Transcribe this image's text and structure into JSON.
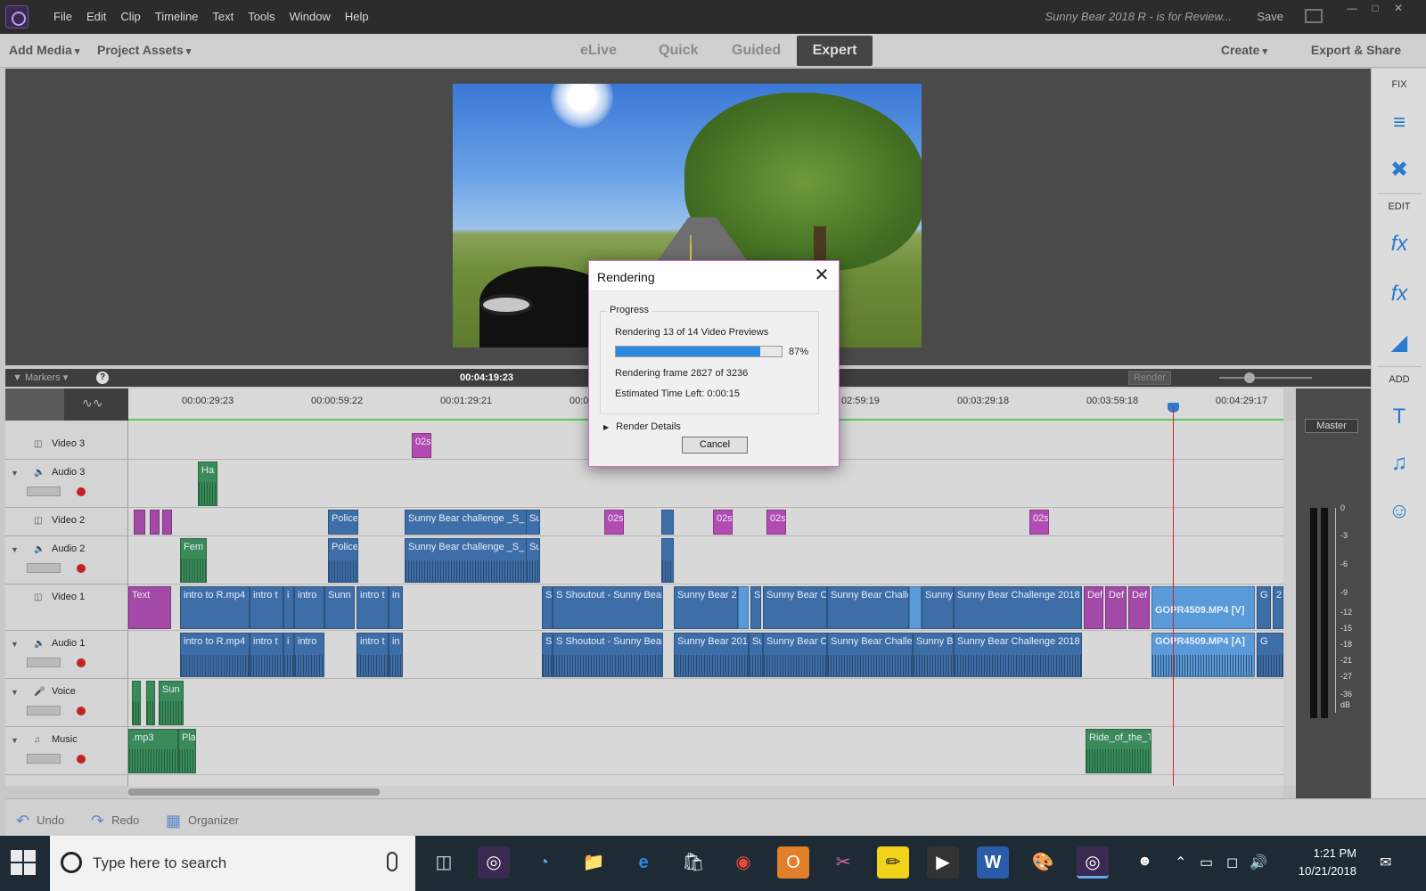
{
  "titlebar": {
    "menu": [
      "File",
      "Edit",
      "Clip",
      "Timeline",
      "Text",
      "Tools",
      "Window",
      "Help"
    ],
    "document_title": "Sunny Bear 2018 R - is for Review...",
    "save_label": "Save"
  },
  "modebar": {
    "add_media": "Add Media",
    "project_assets": "Project Assets",
    "tabs": [
      "eLive",
      "Quick",
      "Guided",
      "Expert"
    ],
    "active_tab": "Expert",
    "create": "Create",
    "export_share": "Export & Share"
  },
  "render_dialog": {
    "title": "Rendering",
    "group_label": "Progress",
    "status_line": "Rendering 13 of 14 Video Previews",
    "progress_percent": 87,
    "percent_label": "87%",
    "frame_line": "Rendering frame 2827 of 3236",
    "time_left": "Estimated Time Left:  0:00:15",
    "details": "Render Details",
    "cancel": "Cancel"
  },
  "timeline": {
    "markers_label": "Markers",
    "current_timecode": "00:04:19:23",
    "render_label": "Render",
    "ruler": [
      "00:00:29:23",
      "00:00:59:22",
      "00:01:29:21",
      "00:0",
      "02:59:19",
      "00:03:29:18",
      "00:03:59:18",
      "00:04:29:17"
    ],
    "tracks": [
      "Video 3",
      "Audio 3",
      "Video 2",
      "Audio 2",
      "Video 1",
      "Audio 1",
      "Voice",
      "Music"
    ],
    "clips": {
      "v3_title": "02s",
      "a3_clip": "Ha",
      "v2_police": "Police",
      "v2_sunny": "Sunny Bear challenge _S_",
      "v2_su": "Su",
      "a2_fem": "Fem",
      "v1_text": "Text",
      "v1_intro": "intro to R.mp4 [",
      "v1_intro_t": "intro t",
      "v1_i": "i",
      "v1_intro2": "intro",
      "v1_sunn": "Sunn",
      "v1_in": "in",
      "v1_s": "S",
      "v1_shoutout": "S Shoutout - Sunny Bear",
      "v1_sb2": "Sunny Bear 2",
      "v1_sbc": "Sunny Bear C",
      "v1_sbchalle": "Sunny Bear Challe",
      "v1_sunny": "Sunny",
      "v1_sbc2018": "Sunny Bear Challenge 2018 -",
      "v1_def": "Def",
      "v1_gopro_v": "GOPR4509.MP4 [V]",
      "v1_g": "G",
      "v1_2": "2",
      "a1_sb201": "Sunny Bear 201",
      "a1_su": "Su",
      "a1_sbchallen": "Sunny Bear Challen",
      "a1_sunnyb": "Sunny B",
      "a1_gopro_a": "GOPR4509.MP4 [A]",
      "voice_sun": "Sun",
      "music_mp3": ".mp3",
      "music_pla": "Pla",
      "music_ride": "Ride_of_the_T"
    }
  },
  "master": {
    "label": "Master",
    "scale": [
      "0",
      "-3",
      "-6",
      "-9",
      "-12",
      "-15",
      "-18",
      "-21",
      "-27",
      "-36",
      "dB"
    ]
  },
  "right_panel": {
    "fix": "FIX",
    "edit": "EDIT",
    "add": "ADD"
  },
  "bottombar": {
    "undo": "Undo",
    "redo": "Redo",
    "organizer": "Organizer"
  },
  "taskbar": {
    "search_placeholder": "Type here to search",
    "time": "1:21 PM",
    "date": "10/21/2018"
  }
}
